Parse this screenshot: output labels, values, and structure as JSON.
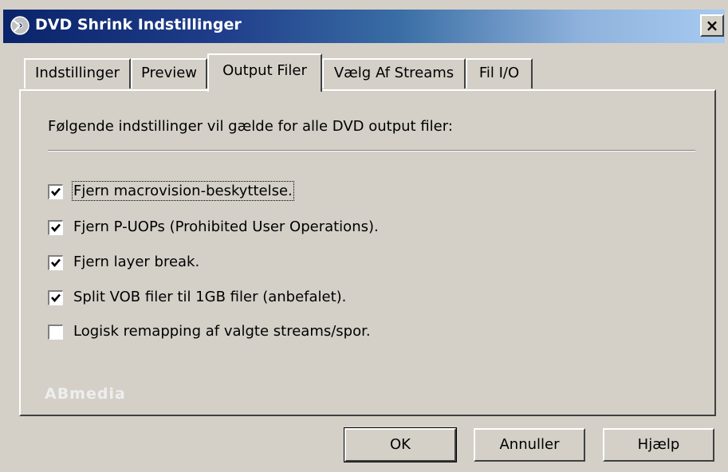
{
  "window": {
    "title": "DVD Shrink Indstillinger",
    "icon": "dvd-shrink-icon",
    "close_label": "×"
  },
  "tabs": [
    {
      "label": "Indstillinger",
      "active": false
    },
    {
      "label": "Preview",
      "active": false
    },
    {
      "label": "Output Filer",
      "active": true
    },
    {
      "label": "Vælg Af Streams",
      "active": false
    },
    {
      "label": "Fil I/O",
      "active": false
    }
  ],
  "panel": {
    "instruction": "Følgende indstillinger vil gælde for alle DVD output filer:",
    "options": [
      {
        "label": "Fjern macrovision-beskyttelse.",
        "checked": true,
        "focused": true
      },
      {
        "label": "Fjern P-UOPs (Prohibited User Operations).",
        "checked": true
      },
      {
        "label": "Fjern layer break.",
        "checked": true
      },
      {
        "label": "Split VOB filer til 1GB filer (anbefalet).",
        "checked": true
      },
      {
        "label": "Logisk remapping af valgte streams/spor.",
        "checked": false
      }
    ],
    "watermark": "ABmedia"
  },
  "buttons": {
    "ok": "OK",
    "cancel": "Annuller",
    "help": "Hjælp"
  },
  "colors": {
    "face": "#d4d0c8",
    "title_start": "#0a246a",
    "title_end": "#a6caf0"
  }
}
